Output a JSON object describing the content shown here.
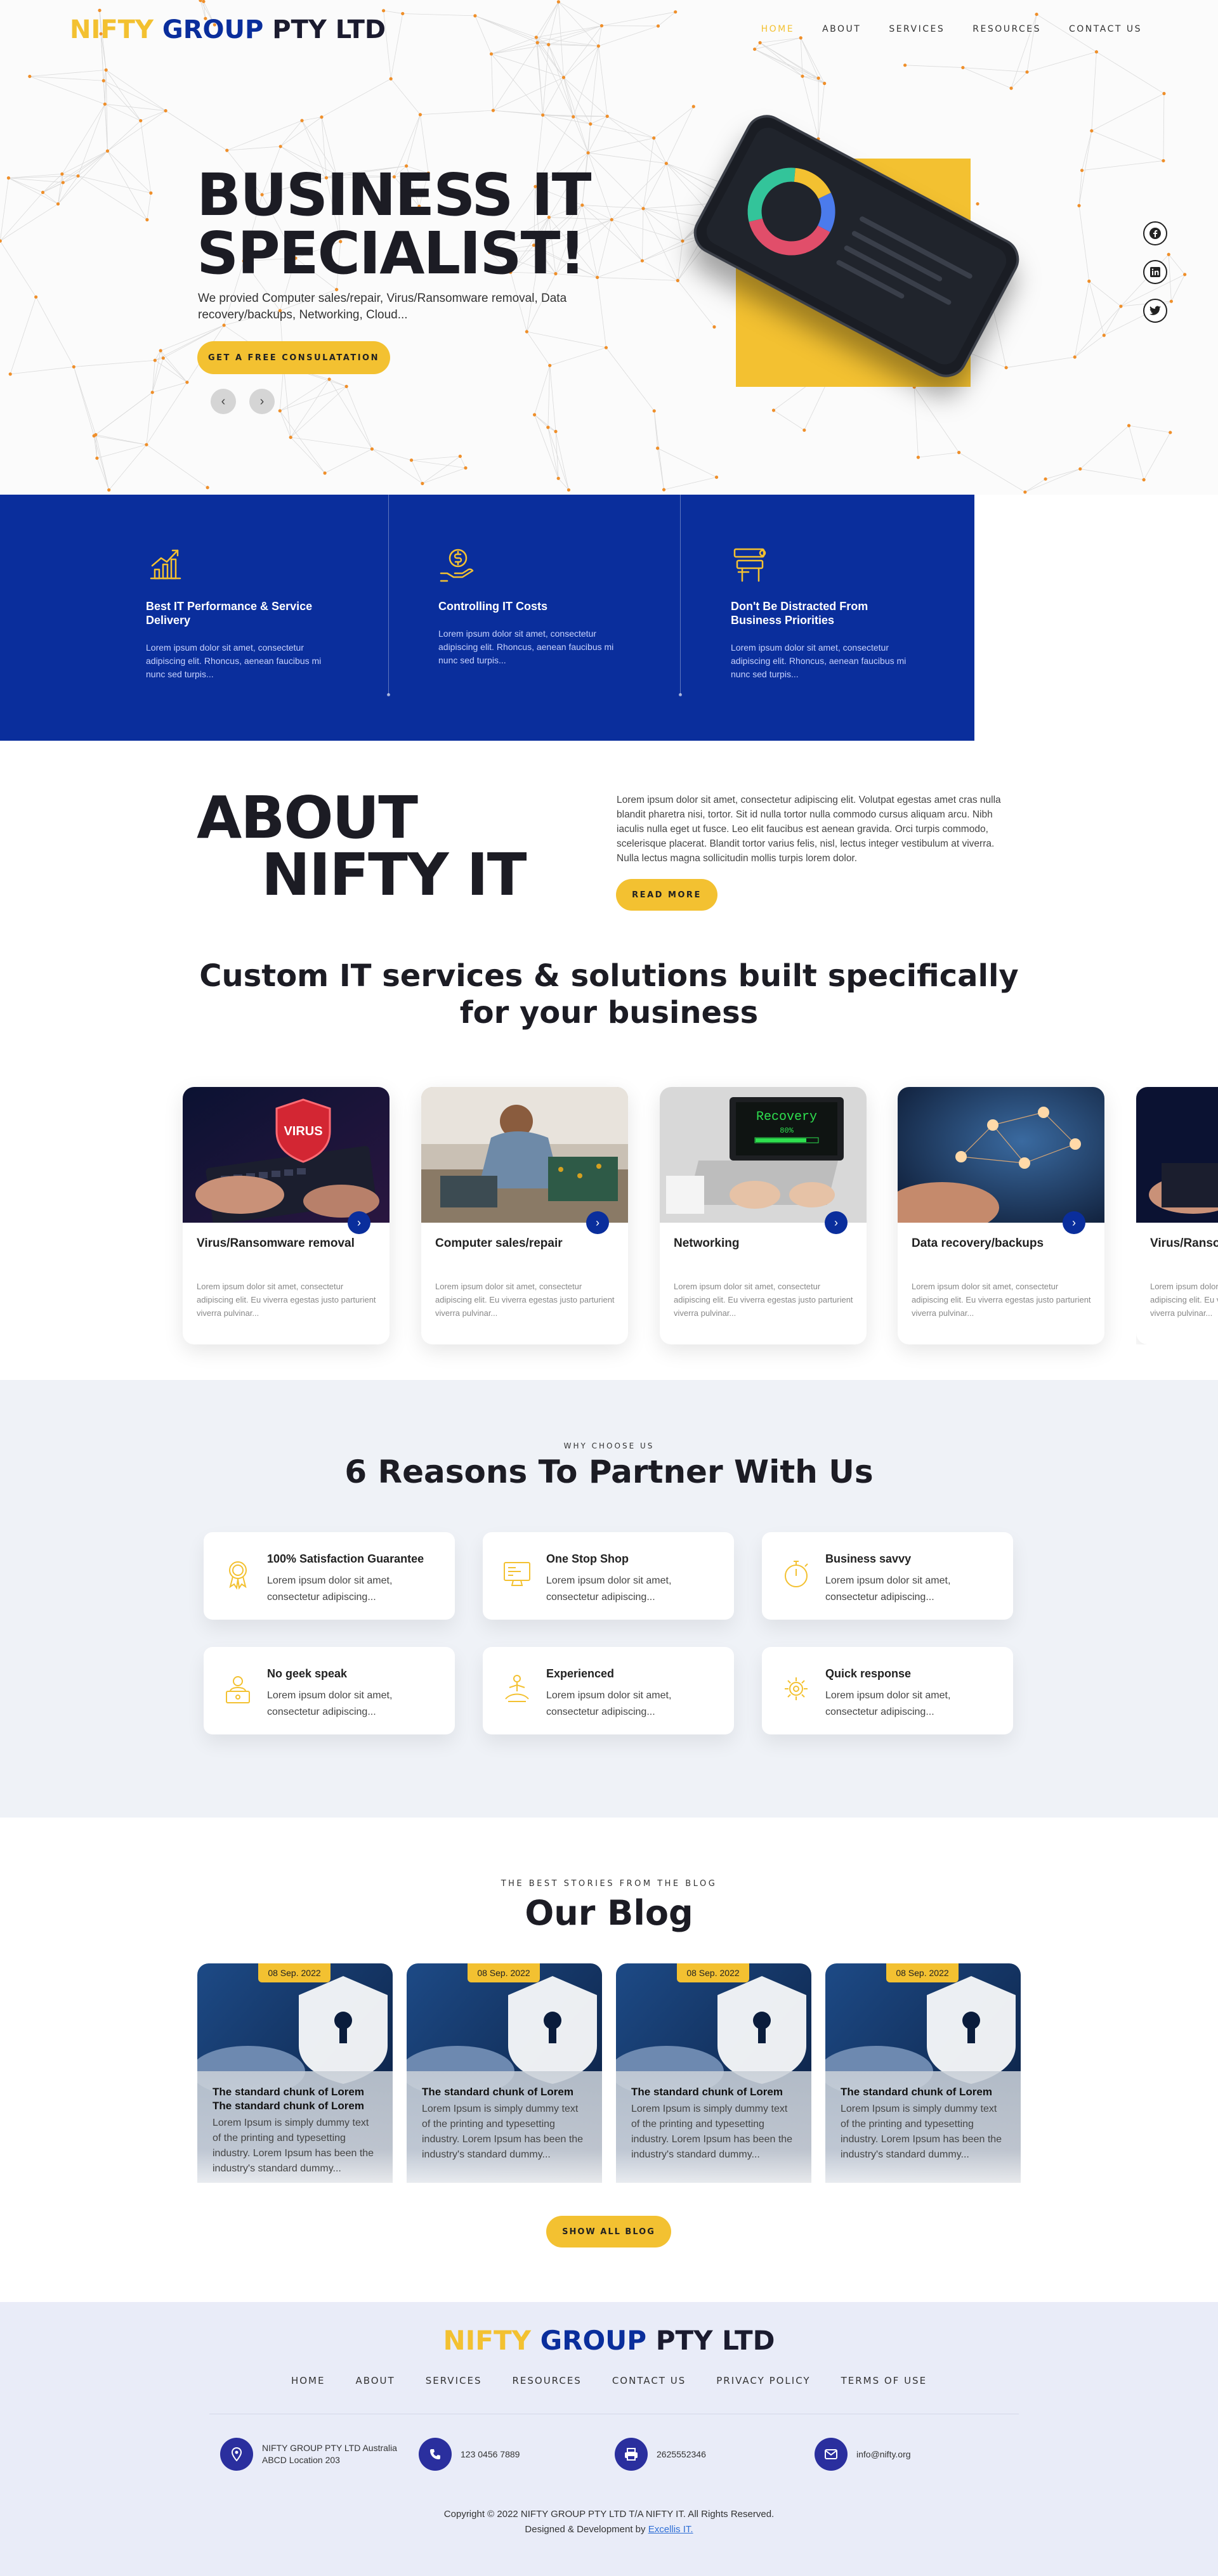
{
  "header": {
    "logo": {
      "part1": "NIFTY",
      "part2": "GROUP",
      "part3": "PTY LTD"
    },
    "nav": [
      "HOME",
      "ABOUT",
      "SERVICES",
      "RESOURCES",
      "CONTACT US"
    ],
    "active_nav": "HOME"
  },
  "hero": {
    "title_line1": "BUSINESS IT",
    "title_line2": "SPECIALIST!",
    "subtitle": "We provied Computer sales/repair, Virus/Ransomware removal, Data recovery/backups, Networking, Cloud...",
    "cta": "GET A FREE CONSULATATION",
    "prev_icon": "‹",
    "next_icon": "›",
    "socials": [
      "facebook-icon",
      "linkedin-icon",
      "twitter-icon"
    ]
  },
  "features": [
    {
      "icon": "growth-chart-icon",
      "title": "Best IT Performance & Service Delivery",
      "text": "Lorem ipsum dolor sit amet, consectetur adipiscing elit. Rhoncus, aenean faucibus mi nunc sed turpis..."
    },
    {
      "icon": "money-hand-icon",
      "title": "Controlling IT Costs",
      "text": "Lorem ipsum dolor sit amet, consectetur adipiscing elit. Rhoncus, aenean faucibus mi nunc sed turpis..."
    },
    {
      "icon": "focus-signpost-icon",
      "title": "Don't Be Distracted From Business Priorities",
      "text": "Lorem ipsum dolor sit amet, consectetur adipiscing elit. Rhoncus, aenean faucibus mi nunc sed turpis..."
    }
  ],
  "about": {
    "title_line1": "ABOUT",
    "title_line2": "NIFTY IT",
    "text": "Lorem ipsum dolor sit amet, consectetur adipiscing elit. Volutpat egestas amet cras nulla blandit pharetra nisi, tortor. Sit id nulla tortor nulla commodo cursus aliquam arcu. Nibh iaculis nulla eget ut fusce. Leo elit faucibus est aenean gravida. Orci turpis commodo, scelerisque placerat. Blandit tortor varius felis, nisl, lectus integer vestibulum at viverra. Nulla lectus magna sollicitudin mollis turpis lorem dolor.",
    "button": "READ MORE"
  },
  "services": {
    "heading": "Custom IT services & solutions built specifically for your business",
    "arrow": "›",
    "cards": [
      {
        "title": "Virus/Ransomware removal",
        "text": "Lorem ipsum dolor sit amet, consectetur adipiscing elit. Eu viverra egestas justo parturient viverra pulvinar..."
      },
      {
        "title": "Computer sales/repair",
        "text": "Lorem ipsum dolor sit amet, consectetur adipiscing elit. Eu viverra egestas justo parturient viverra pulvinar..."
      },
      {
        "title": "Networking",
        "text": "Lorem ipsum dolor sit amet, consectetur adipiscing elit. Eu viverra egestas justo parturient viverra pulvinar...",
        "screen_text": "Recovery",
        "screen_pct": "80%"
      },
      {
        "title": "Data recovery/backups",
        "text": "Lorem ipsum dolor sit amet, consectetur adipiscing elit. Eu viverra egestas justo parturient viverra pulvinar..."
      },
      {
        "title": "Virus/Ransomware removal",
        "text": "Lorem ipsum dolor sit amet, consectetur adipiscing elit. Eu viverra egestas justo parturient viverra pulvinar..."
      }
    ]
  },
  "reasons": {
    "label": "WHY CHOOSE US",
    "title": "6 Reasons To Partner With Us",
    "items": [
      {
        "icon": "award-icon",
        "title": "100% Satisfaction Guarantee",
        "text": "Lorem ipsum dolor sit amet, consectetur adipiscing..."
      },
      {
        "icon": "monitor-icon",
        "title": "One Stop Shop",
        "text": "Lorem ipsum dolor sit amet, consectetur adipiscing..."
      },
      {
        "icon": "stopwatch-icon",
        "title": "Business savvy",
        "text": "Lorem ipsum dolor sit amet, consectetur adipiscing..."
      },
      {
        "icon": "person-laptop-icon",
        "title": "No geek speak",
        "text": "Lorem ipsum dolor sit amet, consectetur adipiscing..."
      },
      {
        "icon": "meditation-icon",
        "title": "Experienced",
        "text": "Lorem ipsum dolor sit amet, consectetur adipiscing..."
      },
      {
        "icon": "gear-network-icon",
        "title": "Quick response",
        "text": "Lorem ipsum dolor sit amet, consectetur adipiscing..."
      }
    ]
  },
  "blog": {
    "label": "THE BEST STORIES FROM THE BLOG",
    "title": "Our Blog",
    "button": "SHOW ALL BLOG",
    "posts": [
      {
        "date": "08 Sep. 2022",
        "title": "The standard chunk of Lorem The standard chunk of Lorem",
        "text": "Lorem Ipsum is simply dummy text of the printing and typesetting industry. Lorem Ipsum has been the industry's standard dummy..."
      },
      {
        "date": "08 Sep. 2022",
        "title": "The standard chunk of Lorem",
        "text": "Lorem Ipsum is simply dummy text of the printing and typesetting industry. Lorem Ipsum has been the industry's standard dummy..."
      },
      {
        "date": "08 Sep. 2022",
        "title": "The standard chunk of Lorem",
        "text": "Lorem Ipsum is simply dummy text of the printing and typesetting industry. Lorem Ipsum has been the industry's standard dummy..."
      },
      {
        "date": "08 Sep. 2022",
        "title": "The standard chunk of Lorem",
        "text": "Lorem Ipsum is simply dummy text of the printing and typesetting industry. Lorem Ipsum has been the industry's standard dummy..."
      }
    ]
  },
  "footer": {
    "logo": {
      "part1": "NIFTY",
      "part2": "GROUP",
      "part3": "PTY LTD"
    },
    "nav": [
      "HOME",
      "ABOUT",
      "SERVICES",
      "RESOURCES",
      "CONTACT US",
      "PRIVACY POLICY",
      "TERMS OF USE"
    ],
    "contacts": [
      {
        "icon": "location-pin-icon",
        "line1": "NIFTY GROUP PTY LTD Australia",
        "line2": "ABCD Location 203"
      },
      {
        "icon": "phone-icon",
        "line1": "123 0456 7889",
        "line2": ""
      },
      {
        "icon": "fax-icon",
        "line1": "2625552346",
        "line2": ""
      },
      {
        "icon": "email-icon",
        "line1": "info@nifty.org",
        "line2": ""
      }
    ],
    "copyright": "Copyright © 2022 NIFTY GROUP PTY LTD T/A NIFTY IT. All Rights Reserved.",
    "credit_prefix": "Designed & Development by",
    "credit_link": "Excellis IT."
  },
  "colors": {
    "accent": "#f3c131",
    "brand_blue": "#0a2e9c",
    "dark": "#1c1c24",
    "reasons_bg": "#eff2f7",
    "footer_bg": "#e9ecf8"
  }
}
